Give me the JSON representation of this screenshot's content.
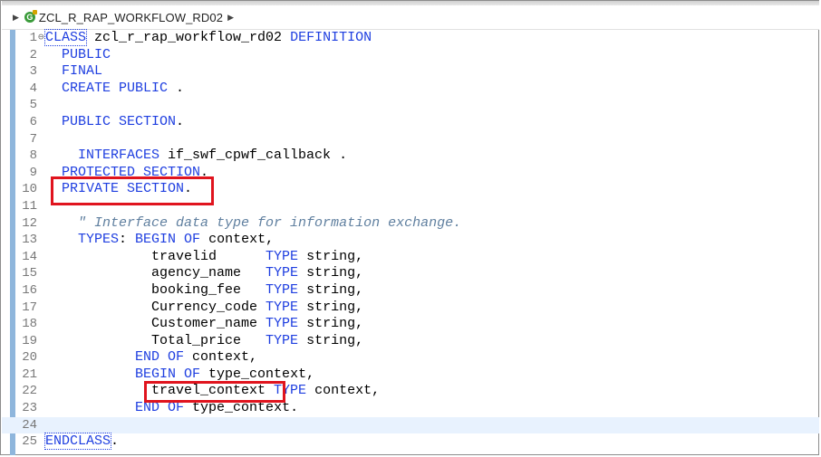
{
  "editor": {
    "breadcrumb": "ZCL_R_RAP_WORKFLOW_RD02",
    "class_icon_glyph": "G",
    "lines": [
      {
        "n": "1",
        "fold": "⊖",
        "segs": [
          {
            "t": "CLASS",
            "c": "kw boxed"
          },
          {
            "t": " zcl_r_rap_workflow_rd02 ",
            "c": ""
          },
          {
            "t": "DEFINITION",
            "c": "kw"
          }
        ]
      },
      {
        "n": "2",
        "segs": [
          {
            "t": "  ",
            "c": ""
          },
          {
            "t": "PUBLIC",
            "c": "kw"
          }
        ]
      },
      {
        "n": "3",
        "segs": [
          {
            "t": "  ",
            "c": ""
          },
          {
            "t": "FINAL",
            "c": "kw"
          }
        ]
      },
      {
        "n": "4",
        "segs": [
          {
            "t": "  ",
            "c": ""
          },
          {
            "t": "CREATE PUBLIC",
            "c": "kw"
          },
          {
            "t": " .",
            "c": ""
          }
        ]
      },
      {
        "n": "5",
        "segs": []
      },
      {
        "n": "6",
        "segs": [
          {
            "t": "  ",
            "c": ""
          },
          {
            "t": "PUBLIC SECTION",
            "c": "kw"
          },
          {
            "t": ".",
            "c": ""
          }
        ]
      },
      {
        "n": "7",
        "segs": []
      },
      {
        "n": "8",
        "segs": [
          {
            "t": "    ",
            "c": ""
          },
          {
            "t": "INTERFACES",
            "c": "kw"
          },
          {
            "t": " if_swf_cpwf_callback .",
            "c": ""
          }
        ]
      },
      {
        "n": "9",
        "segs": [
          {
            "t": "  ",
            "c": ""
          },
          {
            "t": "PROTECTED SECTION",
            "c": "kw"
          },
          {
            "t": ".",
            "c": ""
          }
        ]
      },
      {
        "n": "10",
        "segs": [
          {
            "t": "  ",
            "c": ""
          },
          {
            "t": "PRIVATE SECTION",
            "c": "kw"
          },
          {
            "t": ".",
            "c": ""
          }
        ]
      },
      {
        "n": "11",
        "segs": []
      },
      {
        "n": "12",
        "segs": [
          {
            "t": "    ",
            "c": ""
          },
          {
            "t": "\" Interface data type for information exchange.",
            "c": "cm"
          }
        ]
      },
      {
        "n": "13",
        "segs": [
          {
            "t": "    ",
            "c": ""
          },
          {
            "t": "TYPES",
            "c": "kw"
          },
          {
            "t": ": ",
            "c": ""
          },
          {
            "t": "BEGIN OF",
            "c": "kw"
          },
          {
            "t": " context,",
            "c": ""
          }
        ]
      },
      {
        "n": "14",
        "segs": [
          {
            "t": "             travelid      ",
            "c": ""
          },
          {
            "t": "TYPE",
            "c": "kw"
          },
          {
            "t": " string,",
            "c": ""
          }
        ]
      },
      {
        "n": "15",
        "segs": [
          {
            "t": "             agency_name   ",
            "c": ""
          },
          {
            "t": "TYPE",
            "c": "kw"
          },
          {
            "t": " string,",
            "c": ""
          }
        ]
      },
      {
        "n": "16",
        "segs": [
          {
            "t": "             booking_fee   ",
            "c": ""
          },
          {
            "t": "TYPE",
            "c": "kw"
          },
          {
            "t": " string,",
            "c": ""
          }
        ]
      },
      {
        "n": "17",
        "segs": [
          {
            "t": "             Currency_code ",
            "c": ""
          },
          {
            "t": "TYPE",
            "c": "kw"
          },
          {
            "t": " string,",
            "c": ""
          }
        ]
      },
      {
        "n": "18",
        "segs": [
          {
            "t": "             Customer_name ",
            "c": ""
          },
          {
            "t": "TYPE",
            "c": "kw"
          },
          {
            "t": " string,",
            "c": ""
          }
        ]
      },
      {
        "n": "19",
        "segs": [
          {
            "t": "             Total_price   ",
            "c": ""
          },
          {
            "t": "TYPE",
            "c": "kw"
          },
          {
            "t": " string,",
            "c": ""
          }
        ]
      },
      {
        "n": "20",
        "segs": [
          {
            "t": "           ",
            "c": ""
          },
          {
            "t": "END OF",
            "c": "kw"
          },
          {
            "t": " context,",
            "c": ""
          }
        ]
      },
      {
        "n": "21",
        "segs": [
          {
            "t": "           ",
            "c": ""
          },
          {
            "t": "BEGIN OF",
            "c": "kw"
          },
          {
            "t": " type_context,",
            "c": ""
          }
        ]
      },
      {
        "n": "22",
        "segs": [
          {
            "t": "             travel_context ",
            "c": ""
          },
          {
            "t": "TYPE",
            "c": "kw"
          },
          {
            "t": " context,",
            "c": ""
          }
        ]
      },
      {
        "n": "23",
        "segs": [
          {
            "t": "           ",
            "c": ""
          },
          {
            "t": "END OF",
            "c": "kw"
          },
          {
            "t": " type_context.",
            "c": ""
          }
        ]
      },
      {
        "n": "24",
        "current": true,
        "segs": []
      },
      {
        "n": "25",
        "segs": [
          {
            "t": "ENDCLASS",
            "c": "kw boxed"
          },
          {
            "t": ".",
            "c": ""
          }
        ]
      }
    ]
  },
  "colors": {
    "keyword": "#1f3fe0",
    "comment": "#5f7f9f",
    "highlight_box": "#e0141e",
    "current_line": "#e8f2fe"
  }
}
